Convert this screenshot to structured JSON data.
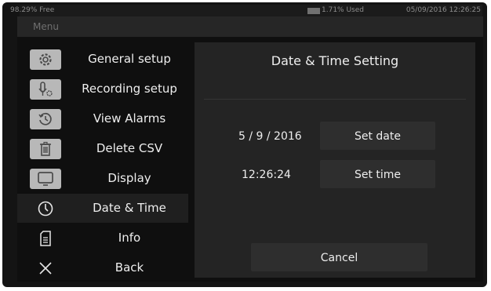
{
  "status_bar": {
    "free": "98.29% Free",
    "used": "1.71% Used",
    "datetime": "05/09/2016 12:26:25"
  },
  "menu": {
    "title": "Menu",
    "items": [
      {
        "label": "General setup",
        "icon": "gear-icon"
      },
      {
        "label": "Recording setup",
        "icon": "recording-setup-icon"
      },
      {
        "label": "View Alarms",
        "icon": "alarm-history-icon"
      },
      {
        "label": "Delete CSV",
        "icon": "trash-icon"
      },
      {
        "label": "Display",
        "icon": "monitor-icon"
      },
      {
        "label": "Date & Time",
        "icon": "clock-icon",
        "active": true
      },
      {
        "label": "Info",
        "icon": "document-icon"
      },
      {
        "label": "Back",
        "icon": "close-icon"
      }
    ]
  },
  "content": {
    "title": "Date & Time Setting",
    "date_value": "5 / 9 / 2016",
    "time_value": "12:26:24",
    "set_date_label": "Set date",
    "set_time_label": "Set time",
    "cancel_label": "Cancel"
  },
  "colors": {
    "background": "#141414",
    "panel": "#242424",
    "button": "#2e2e2e",
    "text": "#eeeeee",
    "icon_tile": "#b8b8b8"
  }
}
